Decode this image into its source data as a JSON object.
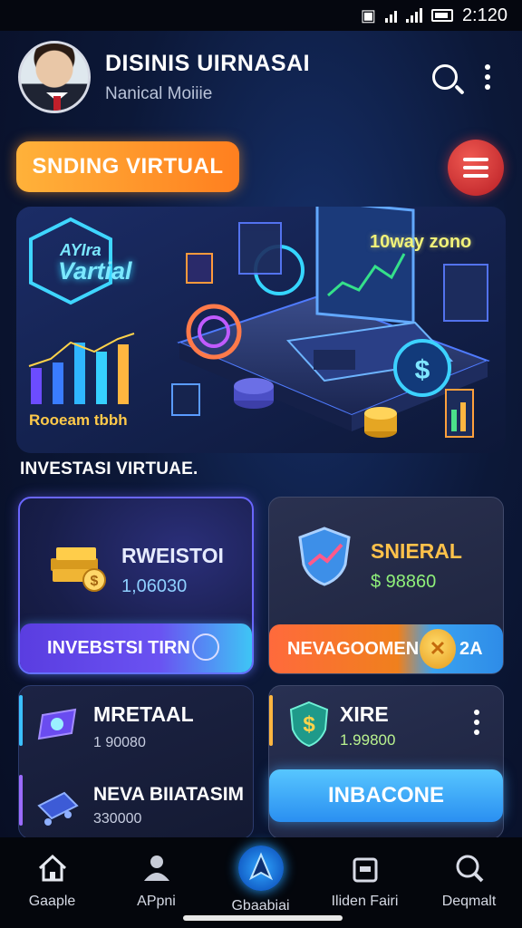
{
  "status_bar": {
    "time": "2:120"
  },
  "header": {
    "title": "DISINIS UIRNASAI",
    "subtitle": "Nanical Moiiie"
  },
  "promo": {
    "button_label": "SNDING VIRTUAL"
  },
  "hero": {
    "logo_small": "AYIra",
    "logo_big": "Vartial",
    "badge": "10way zono",
    "caption": "Rooeam tbbh"
  },
  "section": {
    "title": "INVESTASI VIRTUAE."
  },
  "cards": {
    "invest": {
      "title": "RWEISTOI",
      "value": "1,06030",
      "button": "INVEBSTSI TIRN"
    },
    "general": {
      "title": "SNIERAL",
      "value": "$ 98860",
      "button_left": "NEVAGOOMEN",
      "button_right": "2A"
    },
    "metal": {
      "title": "MRETAAL",
      "value": "1 90080"
    },
    "batasim": {
      "title": "NEVA BIIATASIM",
      "value": "330000"
    },
    "xire": {
      "title": "XIRE",
      "value": "1.99800",
      "button": "INBACONE"
    }
  },
  "nav": {
    "items": [
      {
        "label": "Gaaple",
        "icon": "home-icon"
      },
      {
        "label": "APpni",
        "icon": "profile-icon"
      },
      {
        "label": "Gbaabiai",
        "icon": "navigation-icon"
      },
      {
        "label": "Iliden Fairi",
        "icon": "briefcase-icon"
      },
      {
        "label": "Deqmalt",
        "icon": "search-icon"
      }
    ],
    "active_index": 2
  },
  "colors": {
    "accent_orange": "#ff8a22",
    "accent_red": "#d7262e",
    "accent_blue": "#3aa2f0",
    "accent_purple": "#6a52f2",
    "value_blue": "#8fd0ff",
    "value_green": "#8ff07a",
    "title_gold": "#ffc24a"
  }
}
